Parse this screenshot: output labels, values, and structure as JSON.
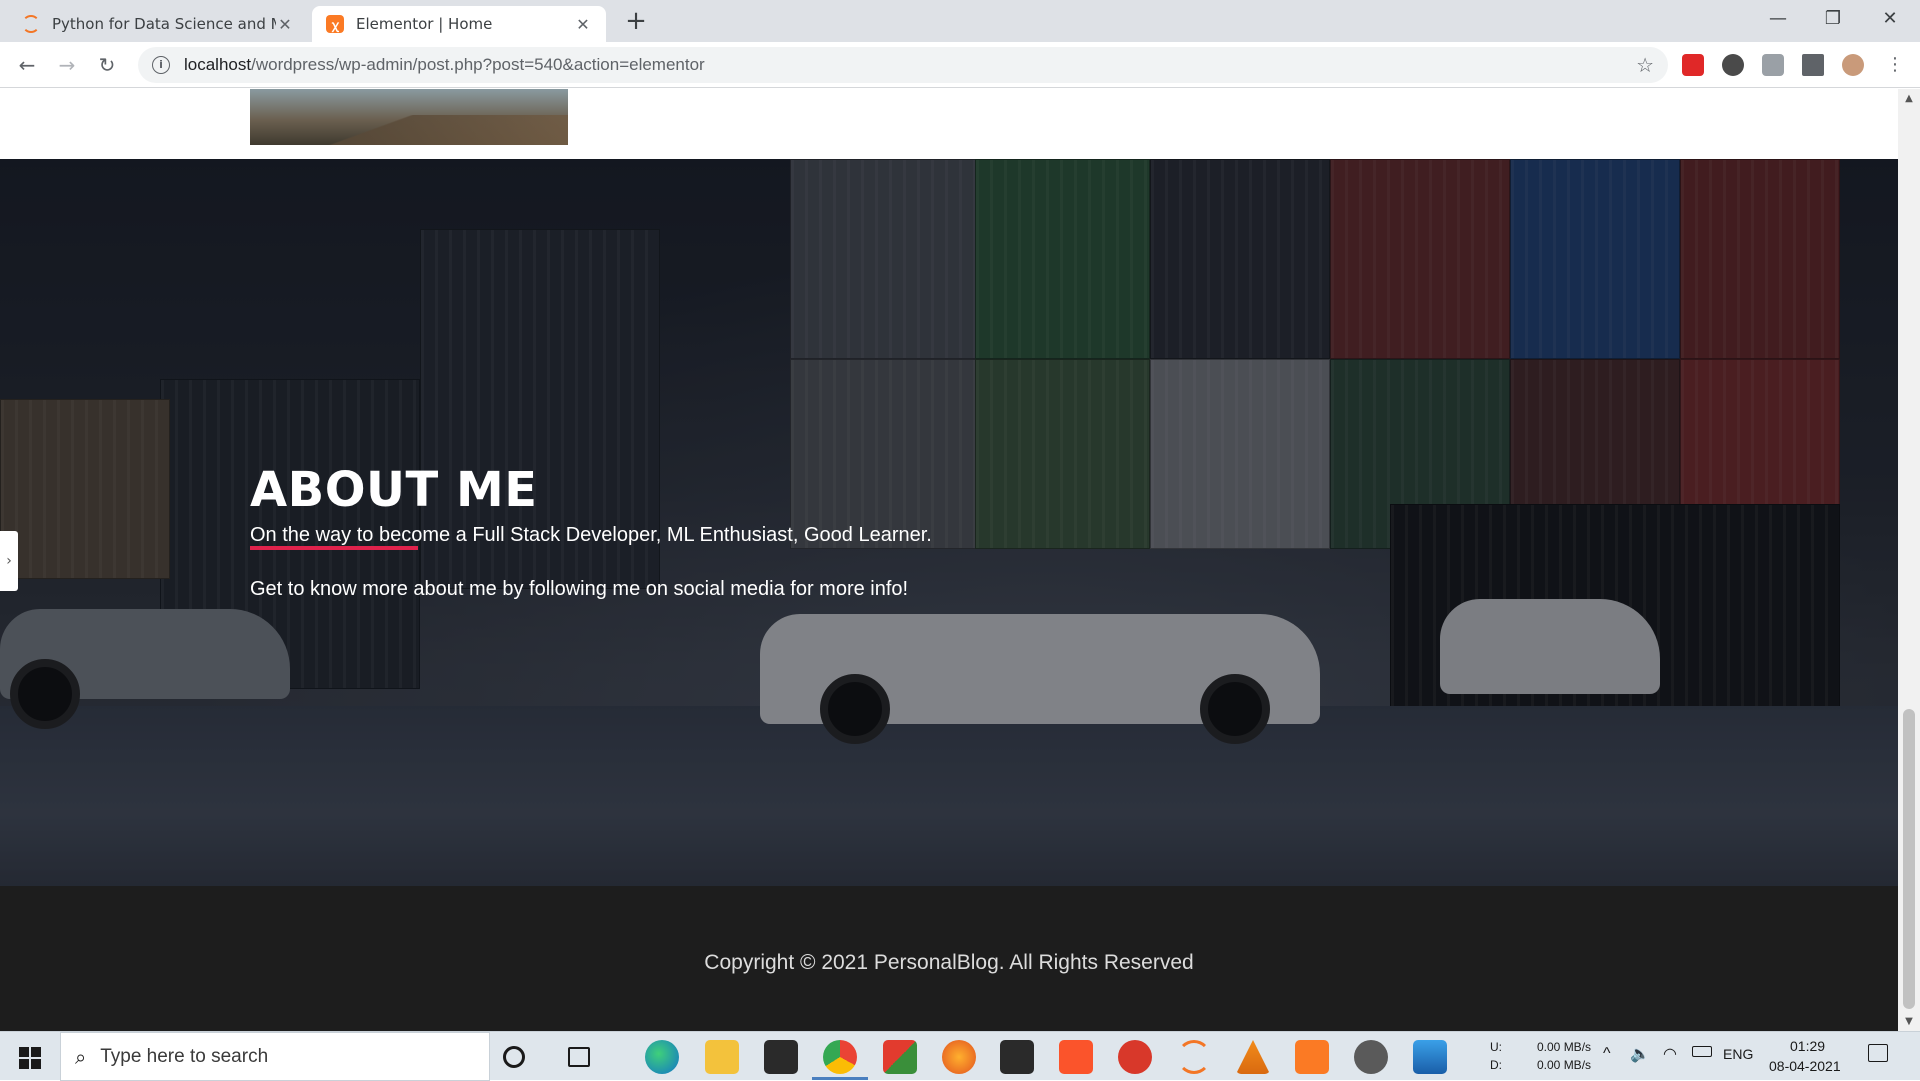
{
  "browser": {
    "tabs": [
      {
        "title": "Python for Data Science and ML/",
        "active": false
      },
      {
        "title": "Elementor | Home",
        "active": true
      }
    ],
    "new_tab": "+",
    "window_controls": {
      "minimize": "—",
      "restore": "❐",
      "close": "✕"
    },
    "url_host": "localhost",
    "url_path": "/wordpress/wp-admin/post.php?post=540&action=elementor"
  },
  "page": {
    "about_title": "ABOUT ME",
    "about_line1": "On the way to become a Full Stack Developer, ML Enthusiast,  Good Learner.",
    "about_line2": "Get to know more about me by following me on social media for more info!",
    "footer_copyright": "Copyright © 2021 PersonalBlog. All Rights Reserved",
    "accent_color": "#e0224c"
  },
  "taskbar": {
    "search_placeholder": "Type here to search",
    "net_upload_label": "U:",
    "net_download_label": "D:",
    "net_upload": "0.00 MB/s",
    "net_download": "0.00 MB/s",
    "language": "ENG",
    "time": "01:29",
    "date": "08-04-2021"
  }
}
